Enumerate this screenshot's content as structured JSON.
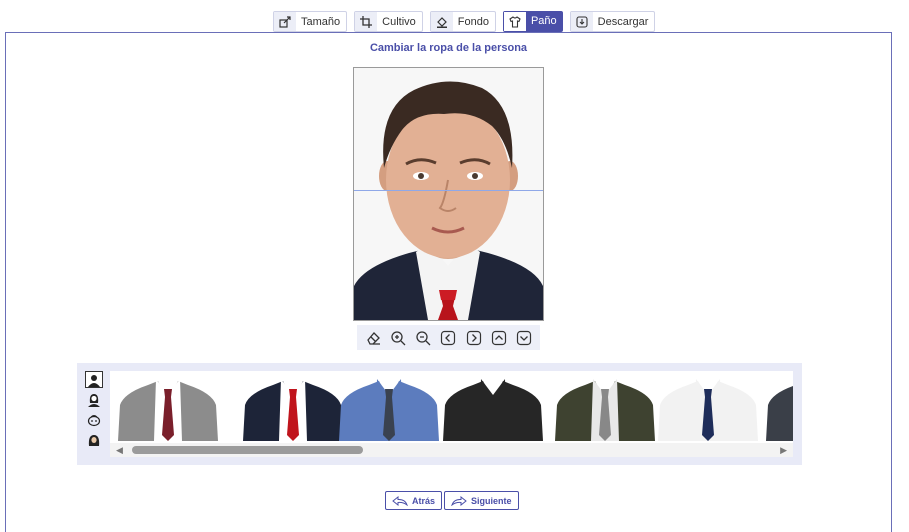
{
  "tabs": [
    {
      "label": "Tamaño",
      "icon": "resize-icon"
    },
    {
      "label": "Cultivo",
      "icon": "crop-icon"
    },
    {
      "label": "Fondo",
      "icon": "fill-icon"
    },
    {
      "label": "Paño",
      "icon": "shirt-icon",
      "active": true
    },
    {
      "label": "Descargar",
      "icon": "download-icon"
    }
  ],
  "main": {
    "title": "Cambiar la ropa de la persona"
  },
  "toolbar": [
    "eraser-icon",
    "zoom-in-icon",
    "zoom-out-icon",
    "move-left-icon",
    "move-right-icon",
    "move-up-icon",
    "move-down-icon"
  ],
  "clothes": {
    "categories": [
      "man-icon",
      "woman-icon",
      "child-icon",
      "hijab-icon"
    ],
    "items": [
      {
        "name": "gray-cardigan-red-tie",
        "jacket": "#8c8c8c",
        "shirt": "#ffffff",
        "tie": "#7a1f2b"
      },
      {
        "name": "navy-suit-red-tie",
        "jacket": "#1d2438",
        "shirt": "#ffffff",
        "tie": "#c0141c"
      },
      {
        "name": "blue-shirt-striped-tie",
        "jacket": "#5c7cbe",
        "shirt": "#5c7cbe",
        "tie": "#3a4250"
      },
      {
        "name": "black-shirt",
        "jacket": "#262626",
        "shirt": "#262626",
        "tie": ""
      },
      {
        "name": "olive-suit-gray-tie",
        "jacket": "#3e4230",
        "shirt": "#e8e8e8",
        "tie": "#888888"
      },
      {
        "name": "white-shirt-navy-tie",
        "jacket": "#f2f2f2",
        "shirt": "#f2f2f2",
        "tie": "#1e2d5a"
      },
      {
        "name": "dark-suit-partial",
        "jacket": "#3a3f48",
        "shirt": "#ffffff",
        "tie": ""
      }
    ]
  },
  "nav": {
    "back": "Atrás",
    "next": "Siguiente"
  },
  "colors": {
    "accent": "#4a4fa8",
    "panel": "#e8eaf7"
  }
}
